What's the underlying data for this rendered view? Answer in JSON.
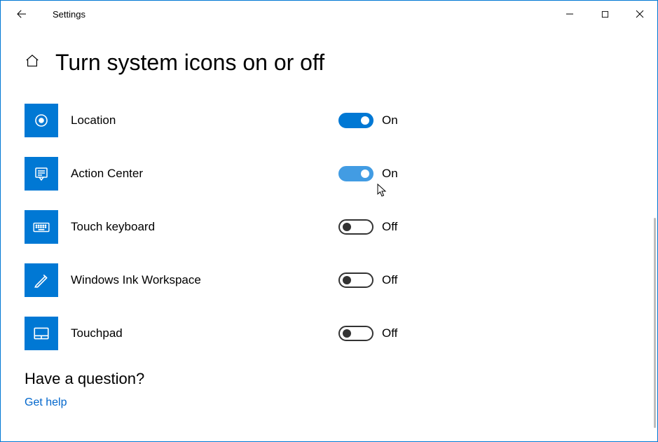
{
  "window": {
    "app_title": "Settings"
  },
  "page": {
    "title": "Turn system icons on or off"
  },
  "toggles": {
    "on_label": "On",
    "off_label": "Off"
  },
  "settings": [
    {
      "key": "location",
      "label": "Location",
      "state": "on"
    },
    {
      "key": "action_center",
      "label": "Action Center",
      "state": "on"
    },
    {
      "key": "touch_keyboard",
      "label": "Touch keyboard",
      "state": "off"
    },
    {
      "key": "ink_workspace",
      "label": "Windows Ink Workspace",
      "state": "off"
    },
    {
      "key": "touchpad",
      "label": "Touchpad",
      "state": "off"
    }
  ],
  "help": {
    "heading": "Have a question?",
    "link_label": "Get help"
  }
}
